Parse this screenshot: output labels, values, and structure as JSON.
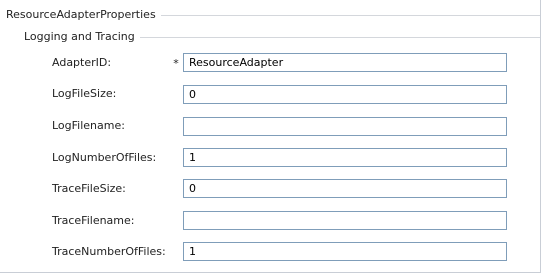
{
  "outer_group": {
    "title": "ResourceAdapterProperties"
  },
  "inner_group": {
    "title": "Logging and Tracing"
  },
  "fields": [
    {
      "label": "AdapterID:",
      "required": "*",
      "value": "ResourceAdapter"
    },
    {
      "label": "LogFileSize:",
      "value": "0"
    },
    {
      "label": "LogFilename:",
      "value": ""
    },
    {
      "label": "LogNumberOfFiles:",
      "value": "1"
    },
    {
      "label": "TraceFileSize:",
      "value": "0"
    },
    {
      "label": "TraceFilename:",
      "value": ""
    },
    {
      "label": "TraceNumberOfFiles:",
      "value": "1"
    }
  ],
  "colors": {
    "input_border": "#7f9db9",
    "group_line": "#d4d7dc",
    "background": "#ffffff"
  }
}
